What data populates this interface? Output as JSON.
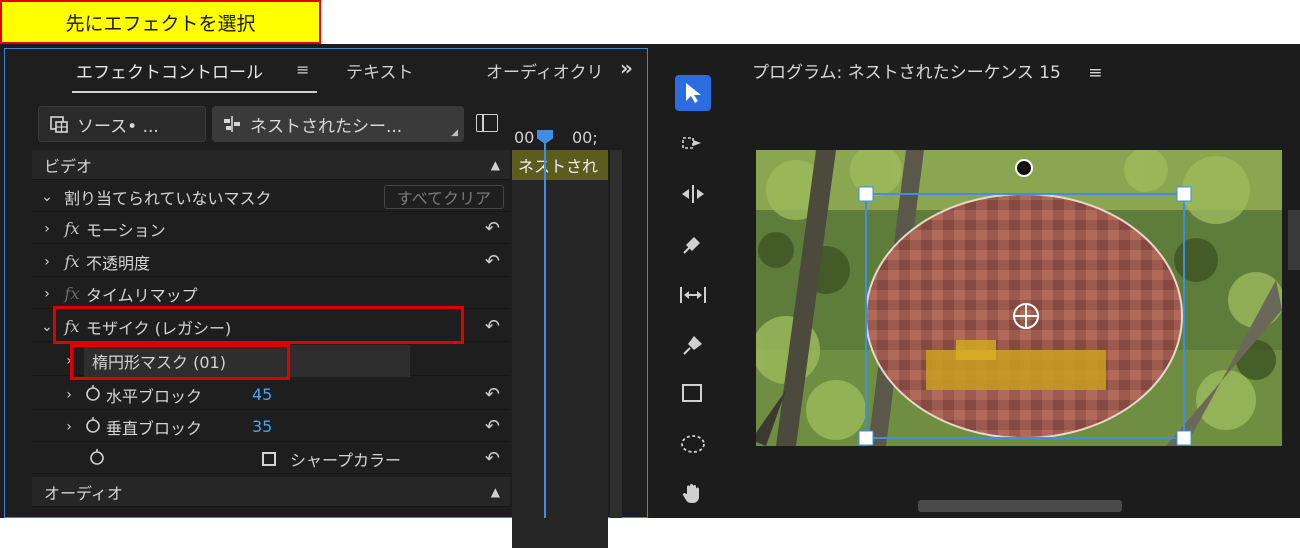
{
  "annotation": {
    "label": "先にエフェクトを選択"
  },
  "effect_panel": {
    "tabs": [
      {
        "label": "エフェクトコントロール"
      },
      {
        "label": "テキスト"
      },
      {
        "label": "オーディオクリ"
      }
    ],
    "menu_glyph": "≡",
    "overflow_glyph": "»",
    "source_dropdown": {
      "label": "ソース• ..."
    },
    "sequence_dropdown": {
      "label": "ネストされたシー..."
    },
    "timecode_left": "00",
    "timecode_right": "00;",
    "timeline_clip_label": "ネストされ",
    "sections": {
      "video": "ビデオ",
      "audio": "オーディオ"
    },
    "mask_row": {
      "label": "割り当てられていないマスク",
      "clear_button": "すべてクリア"
    },
    "effects": [
      {
        "label": "モーション"
      },
      {
        "label": "不透明度"
      },
      {
        "label": "タイムリマップ"
      },
      {
        "label": "モザイク (レガシー)"
      }
    ],
    "mask_item": {
      "label": "楕円形マスク (01)"
    },
    "params": [
      {
        "label": "水平ブロック",
        "value": "45"
      },
      {
        "label": "垂直ブロック",
        "value": "35"
      }
    ],
    "sharp_color": {
      "label": "シャープカラー"
    }
  },
  "program_monitor": {
    "title": "プログラム: ネストされたシーケンス 15"
  },
  "colors": {
    "accent_blue": "#2b6de0",
    "highlight_red": "#e00000",
    "value_blue": "#4aa3f0",
    "annotation_yellow": "#ffff00"
  }
}
